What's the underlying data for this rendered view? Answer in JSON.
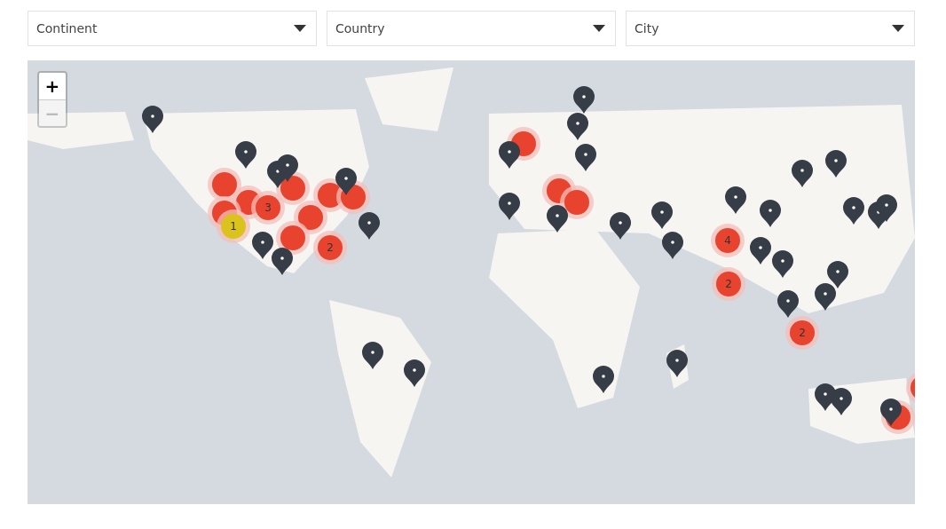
{
  "filters": [
    {
      "placeholder": "Continent"
    },
    {
      "placeholder": "Country"
    },
    {
      "placeholder": "City"
    }
  ],
  "map": {
    "zoom_in": "+",
    "zoom_out": "−",
    "zoom_out_disabled": true,
    "clusters": [
      {
        "count": "1",
        "color": "#d9c31c"
      },
      {
        "count": "3",
        "color": "#e8432f"
      },
      {
        "count": "2",
        "color": "#e8432f"
      },
      {
        "count": "4",
        "color": "#e8432f"
      },
      {
        "count": "2",
        "color": "#e8432f"
      },
      {
        "count": "2",
        "color": "#e8432f"
      }
    ]
  }
}
